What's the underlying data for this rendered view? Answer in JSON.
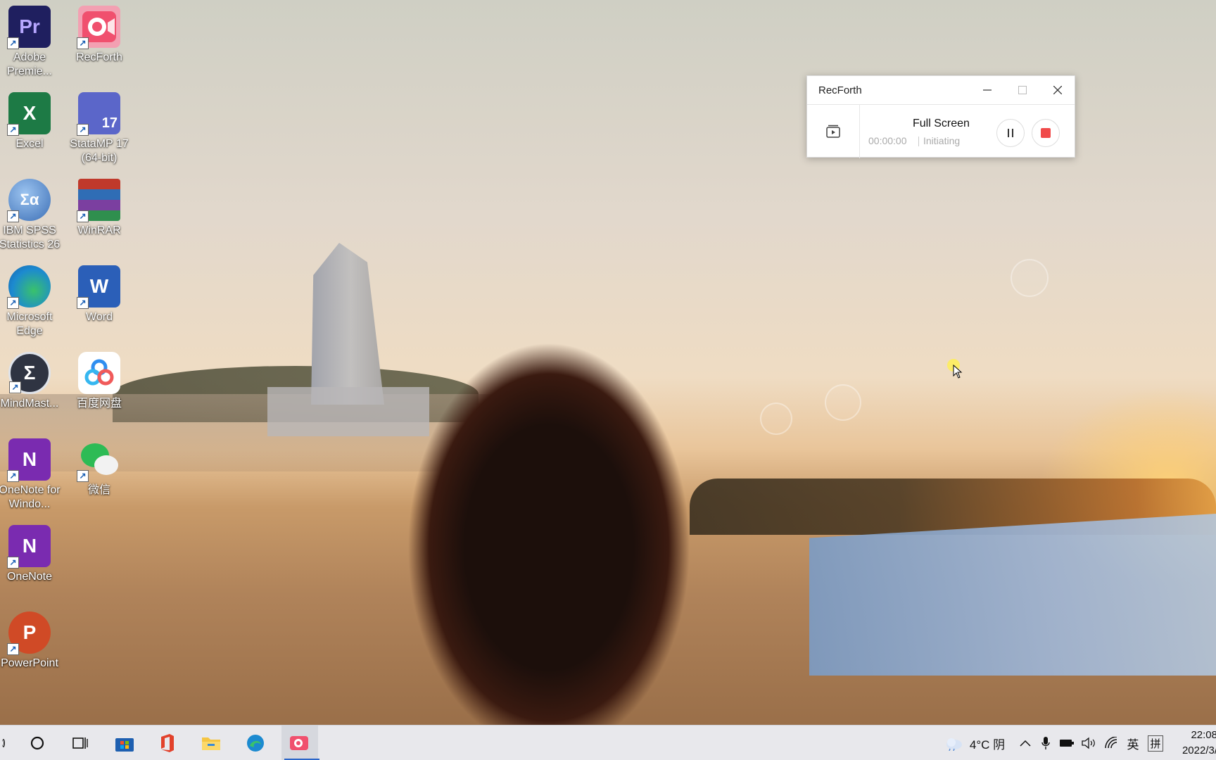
{
  "desktop": {
    "icons": [
      {
        "label": "Adobe Premie...",
        "icon": "adobe-premiere-icon",
        "letter": "Pr",
        "color": "#1f1f5f"
      },
      {
        "label": "RecForth",
        "icon": "recforth-icon",
        "color": "#f0506e"
      },
      {
        "label": "Excel",
        "icon": "excel-icon",
        "letter": "X",
        "color": "#1d7a45"
      },
      {
        "label": "StataMP 17 (64-bit)",
        "icon": "stata-icon",
        "letter": "17",
        "color": "#5b66c9"
      },
      {
        "label": "IBM SPSS Statistics 26",
        "icon": "spss-icon",
        "letter": "Σα",
        "color": "#4a7cc3"
      },
      {
        "label": "WinRAR",
        "icon": "winrar-icon",
        "color": "#8a2c6c"
      },
      {
        "label": "Microsoft Edge",
        "icon": "edge-icon",
        "color": "#1c8ad0"
      },
      {
        "label": "Word",
        "icon": "word-icon",
        "letter": "W",
        "color": "#2b5fb8"
      },
      {
        "label": "MindMast...",
        "icon": "mindmaster-icon",
        "letter": "Σ",
        "color": "#2f3442"
      },
      {
        "label": "百度网盘",
        "icon": "baidu-netdisk-icon",
        "color": "#ffffff"
      },
      {
        "label": "OneNote for Windo...",
        "icon": "onenote-icon",
        "letter": "N",
        "color": "#7a2bb0"
      },
      {
        "label": "微信",
        "icon": "wechat-icon",
        "color": "#2dbb55"
      },
      {
        "label": "OneNote",
        "icon": "onenote-icon",
        "letter": "N",
        "color": "#7a2bb0"
      },
      {
        "label": "PowerPoint",
        "icon": "powerpoint-icon",
        "letter": "P",
        "color": "#d04a26"
      }
    ]
  },
  "recforth_window": {
    "title": "RecForth",
    "mode": "Full Screen",
    "timer": "00:00:00",
    "status": "Initiating",
    "stop_color": "#f04a4a"
  },
  "taskbar": {
    "weather": "4°C 阴",
    "ime_lang": "英",
    "ime_mode": "拼",
    "time": "22:08",
    "date": "2022/3/"
  }
}
